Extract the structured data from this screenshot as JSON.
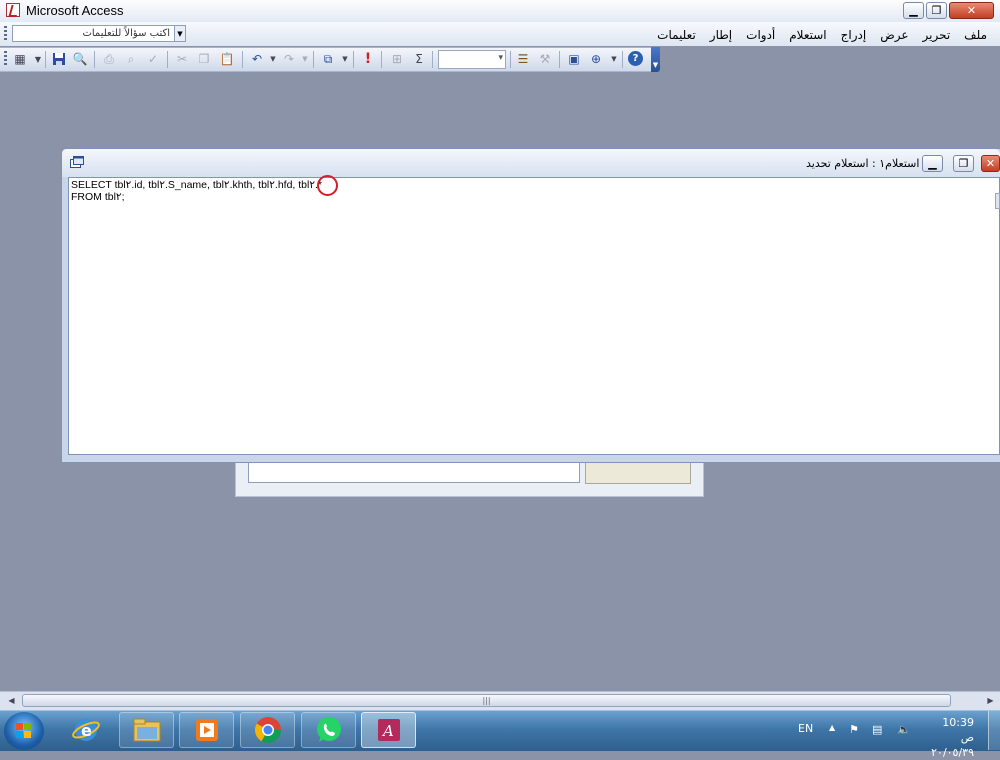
{
  "window": {
    "title": "Microsoft Access",
    "controls": {
      "minimize": "▁",
      "restore": "❐",
      "close": "✕"
    }
  },
  "menubar": {
    "ask_placeholder": "اكتب سؤالاً للتعليمات",
    "items": [
      "ملف",
      "تحرير",
      "عرض",
      "إدراج",
      "استعلام",
      "أدوات",
      "إطار",
      "تعليمات"
    ]
  },
  "toolbar": {
    "icons": [
      "view-icon",
      "save-icon",
      "search-file-icon",
      "print-icon",
      "print-preview-icon",
      "spelling-icon",
      "cut-icon",
      "copy-icon",
      "paste-icon",
      "undo-icon",
      "redo-icon",
      "query-type-icon",
      "run-icon",
      "show-table-icon",
      "totals-icon",
      "properties-icon",
      "build-icon",
      "database-window-icon",
      "new-object-icon",
      "help-icon"
    ],
    "totals_symbol": "Σ",
    "run_symbol": "!",
    "help_symbol": "?"
  },
  "query_window": {
    "title": "استعلام١ : استعلام تحديد",
    "sql_lines": [
      "SELECT tbl٢.id, tbl٢.S_name, tbl٢.khth, tbl٢.hfd, tbl٢.*",
      "FROM tbl٢;"
    ]
  },
  "taskbar": {
    "apps": [
      "internet-explorer",
      "file-explorer",
      "media-player",
      "chrome",
      "whatsapp",
      "microsoft-access"
    ],
    "language": "EN",
    "time": "10:39 ص",
    "date": "٢٠/٠٥/٣٩"
  },
  "colors": {
    "workspace": "#8a93a8",
    "accent": "#2a4f96",
    "highlight_circle": "#d0202a"
  }
}
